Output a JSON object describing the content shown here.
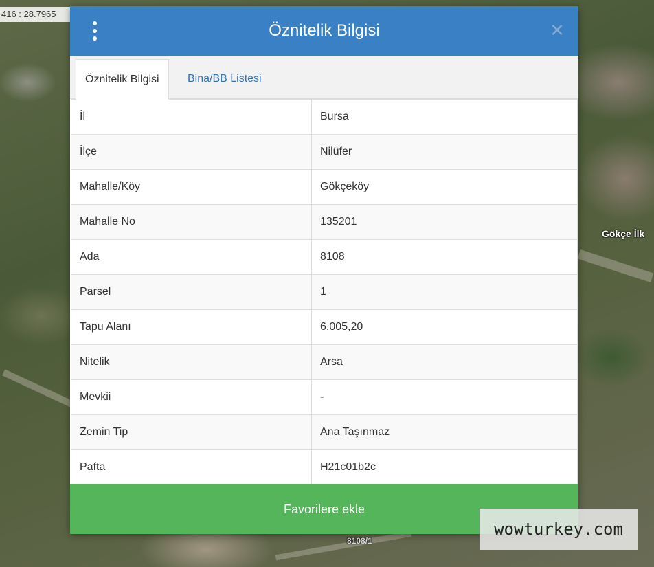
{
  "map": {
    "coordinate_readout": "416 : 28.7965",
    "place_label": "Gökçe İlk",
    "parcel_label": "8108/1"
  },
  "modal": {
    "title": "Öznitelik Bilgisi",
    "close_symbol": "✕",
    "tabs": [
      {
        "label": "Öznitelik Bilgisi",
        "active": true
      },
      {
        "label": "Bina/BB Listesi",
        "active": false
      }
    ],
    "rows": [
      {
        "key": "İl",
        "value": "Bursa"
      },
      {
        "key": "İlçe",
        "value": "Nilüfer"
      },
      {
        "key": "Mahalle/Köy",
        "value": "Gökçeköy"
      },
      {
        "key": "Mahalle No",
        "value": "135201"
      },
      {
        "key": "Ada",
        "value": "8108"
      },
      {
        "key": "Parsel",
        "value": "1"
      },
      {
        "key": "Tapu Alanı",
        "value": "6.005,20"
      },
      {
        "key": "Nitelik",
        "value": "Arsa"
      },
      {
        "key": "Mevkii",
        "value": "-"
      },
      {
        "key": "Zemin Tip",
        "value": "Ana Taşınmaz"
      },
      {
        "key": "Pafta",
        "value": "H21c01b2c"
      }
    ],
    "favorite_button_label": "Favorilere ekle"
  },
  "watermark": "wowturkey.com",
  "colors": {
    "header": "#3a80c4",
    "tab_link": "#2f73b8",
    "favorite_button": "#55b55a"
  },
  "icons": {
    "menu": "kebab-menu-icon",
    "close": "close-icon"
  }
}
